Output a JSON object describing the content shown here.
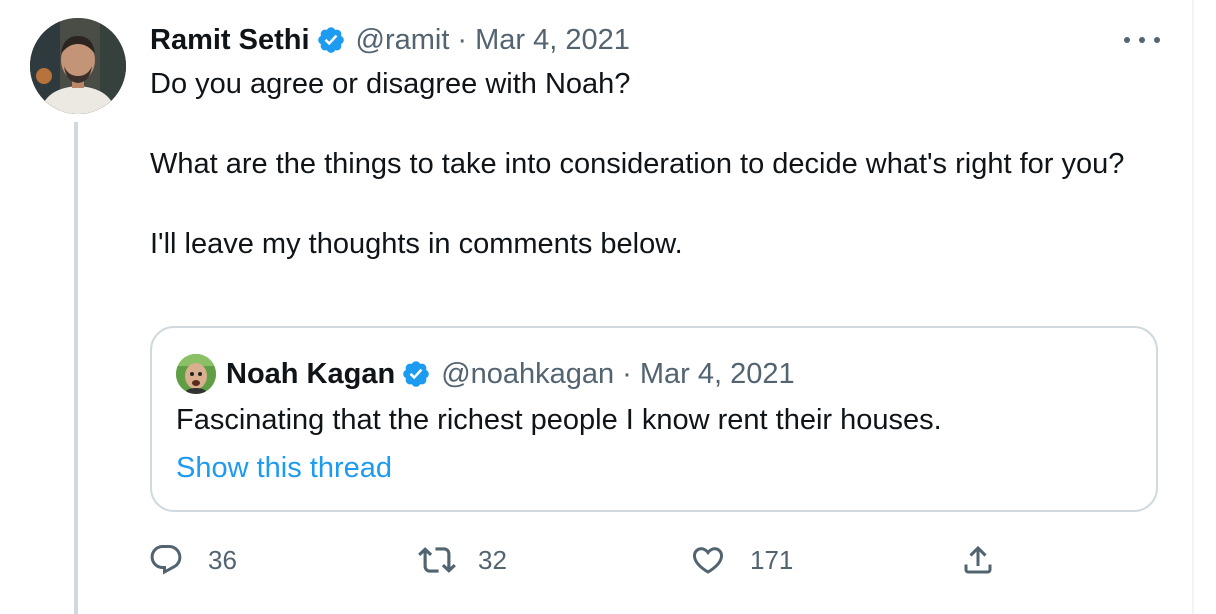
{
  "tweet": {
    "author_name": "Ramit Sethi",
    "author_handle": "@ramit",
    "separator": "·",
    "date": "Mar 4, 2021",
    "text_line1": "Do you agree or disagree with Noah?",
    "text_line2": "What are the things to take into consideration to decide what's right for you?",
    "text_line3": "I'll leave my thoughts in comments below."
  },
  "quoted_tweet": {
    "author_name": "Noah Kagan",
    "author_handle": "@noahkagan",
    "separator": "·",
    "date": "Mar 4, 2021",
    "text": "Fascinating that the richest people I know rent their houses.",
    "show_thread_label": "Show this thread"
  },
  "actions": {
    "reply_count": "36",
    "retweet_count": "32",
    "like_count": "171"
  },
  "colors": {
    "verified_blue": "#1d9bf0",
    "link_blue": "#1d9bf0",
    "secondary_text": "#536471",
    "border": "#cfd9de"
  },
  "icons": {
    "verified": "verified-badge-icon",
    "more": "more-dots-icon",
    "reply": "reply-icon",
    "retweet": "retweet-icon",
    "like": "heart-icon",
    "share": "share-icon"
  }
}
